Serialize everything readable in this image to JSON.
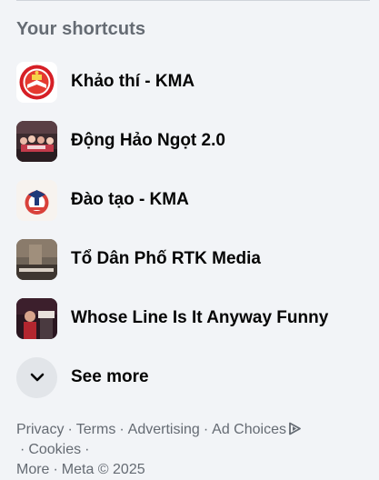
{
  "section_title": "Your shortcuts",
  "shortcuts": [
    {
      "label": "Khảo thí - KMA",
      "icon": "kma-seal-icon"
    },
    {
      "label": "Động Hảo Ngọt 2.0",
      "icon": "group-photo-icon"
    },
    {
      "label": "Đào tạo - KMA",
      "icon": "kma-training-icon"
    },
    {
      "label": "Tổ Dân Phố RTK Media",
      "icon": "rtk-media-icon"
    },
    {
      "label": "Whose Line Is It Anyway Funny",
      "icon": "whose-line-icon"
    }
  ],
  "see_more": {
    "label": "See more",
    "icon": "chevron-down-icon"
  },
  "footer": {
    "links": [
      "Privacy",
      "Terms",
      "Advertising",
      "Ad Choices",
      "Cookies",
      "More"
    ],
    "copyright": "Meta © 2025",
    "separator": "·"
  },
  "colors": {
    "background": "#f2f4f7",
    "muted_text": "#656b73",
    "primary_text": "#050505",
    "see_more_bg": "#e2e5e9"
  }
}
